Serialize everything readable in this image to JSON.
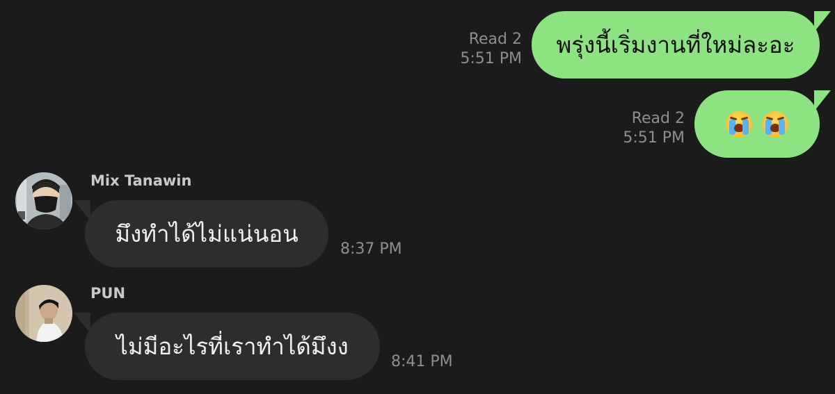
{
  "colors": {
    "background": "#1b1b1b",
    "sent_bubble": "#8de382",
    "received_bubble": "#2d2d2d",
    "meta_text": "#8e8e8e"
  },
  "messages": [
    {
      "direction": "outgoing",
      "text": "พรุ่งนี้เริ่มงานที่ใหม่ละอะ",
      "read_status": "Read 2",
      "time": "5:51 PM"
    },
    {
      "direction": "outgoing",
      "emojis": [
        "loudly-crying-face-icon",
        "loudly-crying-face-icon"
      ],
      "read_status": "Read 2",
      "time": "5:51 PM"
    },
    {
      "direction": "incoming",
      "sender": "Mix Tanawin",
      "text": "มึงทำได้ไม่แน่นอน",
      "time": "8:37 PM"
    },
    {
      "direction": "incoming",
      "sender": "PUN",
      "text": "ไม่มีอะไรที่เราทำได้มึงง",
      "time": "8:41 PM"
    }
  ]
}
